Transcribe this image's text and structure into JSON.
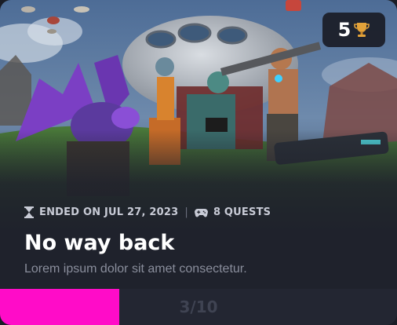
{
  "badge": {
    "count": "5",
    "icon": "trophy-icon",
    "icon_color": "#e2a23a"
  },
  "meta": {
    "status_icon": "hourglass-icon",
    "status_text": "ENDED ON JUL 27, 2023",
    "separator": "|",
    "quests_icon": "gamepad-icon",
    "quests_text": "8 QUESTS"
  },
  "title": "No way back",
  "description": "Lorem ipsum dolor sit amet consectetur.",
  "progress": {
    "label": "3/10",
    "current": 3,
    "total": 10,
    "fill_color": "#ff0cc8"
  },
  "colors": {
    "card_bg": "#1f222c",
    "accent": "#ff0cc8"
  }
}
